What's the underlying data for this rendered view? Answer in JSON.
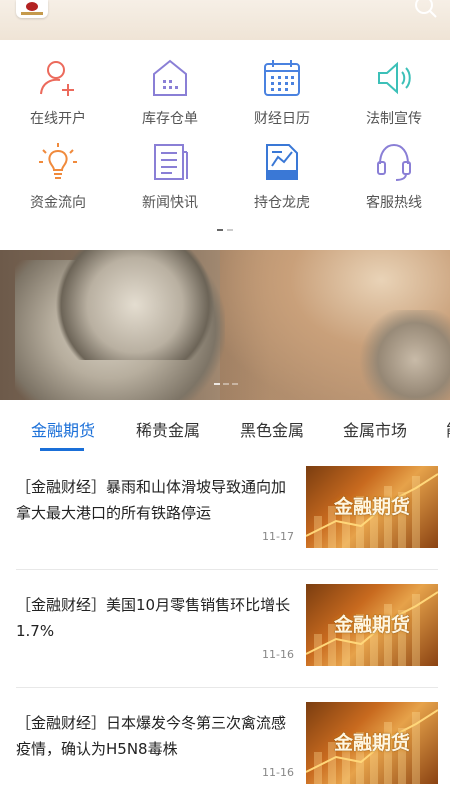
{
  "header": {
    "logo_icon": "brand-logo",
    "search_icon": "search-icon"
  },
  "grid": {
    "items": [
      {
        "label": "在线开户",
        "icon": "user-add-icon",
        "color": "#ec6a5c"
      },
      {
        "label": "库存仓单",
        "icon": "warehouse-icon",
        "color": "#8a7fd6"
      },
      {
        "label": "财经日历",
        "icon": "calendar-icon",
        "color": "#4a82e0"
      },
      {
        "label": "法制宣传",
        "icon": "speaker-icon",
        "color": "#3cc0b8"
      },
      {
        "label": "资金流向",
        "icon": "lightbulb-icon",
        "color": "#f08a3c"
      },
      {
        "label": "新闻快讯",
        "icon": "news-icon",
        "color": "#8a7fd6"
      },
      {
        "label": "持仓龙虎",
        "icon": "chart-doc-icon",
        "color": "#3a78d6"
      },
      {
        "label": "客服热线",
        "icon": "headset-icon",
        "color": "#8a7fd6"
      }
    ]
  },
  "tabs": [
    {
      "label": "金融期货",
      "active": true
    },
    {
      "label": "稀贵金属",
      "active": false
    },
    {
      "label": "黑色金属",
      "active": false
    },
    {
      "label": "金属市场",
      "active": false
    },
    {
      "label": "能",
      "active": false
    }
  ],
  "news": [
    {
      "text": "［金融财经］暴雨和山体滑坡导致通向加拿大最大港口的所有铁路停运",
      "date": "11-17",
      "thumb_label": "金融期货"
    },
    {
      "text": "［金融财经］美国10月零售销售环比增长1.7%",
      "date": "11-16",
      "thumb_label": "金融期货"
    },
    {
      "text": "［金融财经］日本爆发今冬第三次禽流感疫情，确认为H5N8毒株",
      "date": "11-16",
      "thumb_label": "金融期货"
    }
  ],
  "colors": {
    "accent": "#1a6fd8"
  }
}
